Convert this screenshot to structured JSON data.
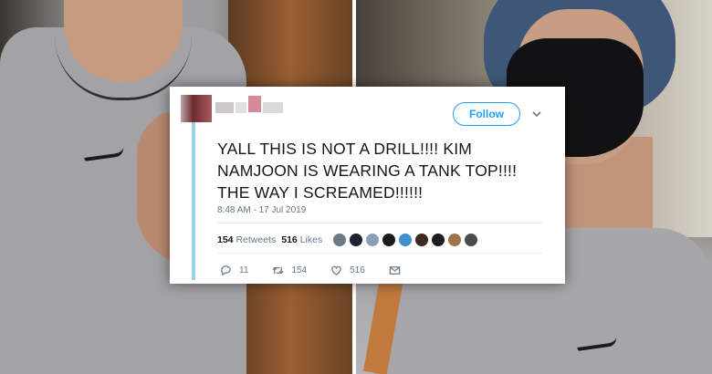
{
  "tweet": {
    "follow_label": "Follow",
    "text": "YALL THIS IS NOT A DRILL!!!! KIM NAMJOON IS WEARING A TANK TOP!!!! THE WAY I SCREAMED!!!!!!",
    "timestamp": "8:48 AM - 17 Jul 2019",
    "retweets_count": "154",
    "retweets_label": "Retweets",
    "likes_count": "516",
    "likes_label": "Likes",
    "actions": {
      "reply_count": "11",
      "retweet_count": "154",
      "like_count": "516"
    },
    "liker_avatar_colors": [
      "#6b7a86",
      "#1f2330",
      "#8aa0b8",
      "#1a1a1a",
      "#3f8fd1",
      "#3a2a22",
      "#1d1d1d",
      "#a0744c",
      "#4b4b4b"
    ],
    "accent_color": "#1da1f2"
  },
  "icons": {
    "reply": "reply-icon",
    "retweet": "retweet-icon",
    "like": "heart-icon",
    "dm": "envelope-icon",
    "menu": "chevron-down-icon"
  }
}
